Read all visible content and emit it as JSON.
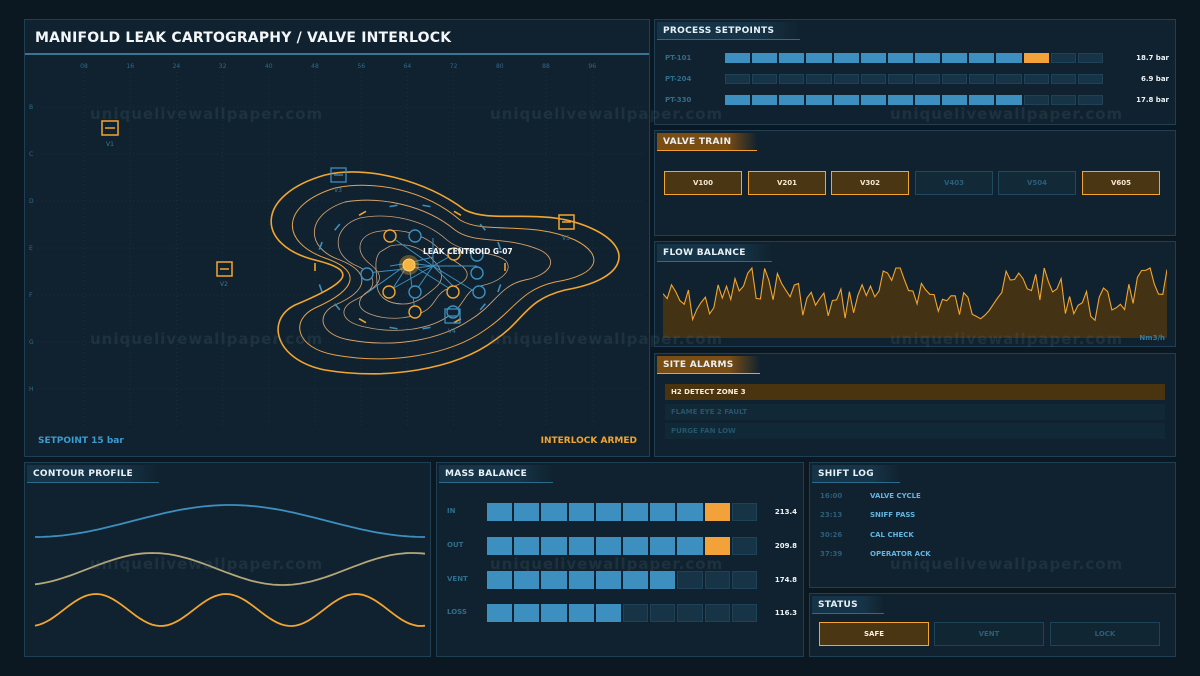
{
  "map": {
    "title": "MANIFOLD LEAK CARTOGRAPHY / VALVE INTERLOCK",
    "x_ticks": [
      "08",
      "16",
      "24",
      "32",
      "40",
      "48",
      "56",
      "64",
      "72",
      "80",
      "88",
      "96"
    ],
    "y_ticks": [
      "B",
      "C",
      "D",
      "E",
      "F",
      "G",
      "H"
    ],
    "valve_labels": [
      "V1",
      "V2",
      "V3",
      "V4",
      "V5"
    ],
    "centroid_label": "LEAK CENTROID  G-07",
    "setpoint": "SETPOINT 15 bar",
    "interlock": "INTERLOCK ARMED"
  },
  "setpoints": {
    "title": "PROCESS SETPOINTS",
    "rows": [
      {
        "label": "PT-101",
        "value": "18.7 bar",
        "level": 0.86
      },
      {
        "label": "PT-204",
        "value": "6.9 bar",
        "level": 0.0
      },
      {
        "label": "PT-330",
        "value": "17.8 bar",
        "level": 0.79
      }
    ]
  },
  "valve_train": {
    "title": "VALVE TRAIN",
    "valves": [
      {
        "label": "V100",
        "state": "on"
      },
      {
        "label": "V201",
        "state": "on"
      },
      {
        "label": "V302",
        "state": "on"
      },
      {
        "label": "V403",
        "state": "off"
      },
      {
        "label": "V504",
        "state": "off"
      },
      {
        "label": "V605",
        "state": "on"
      }
    ]
  },
  "flow": {
    "title": "FLOW BALANCE",
    "unit": "Nm3/h"
  },
  "alarms": {
    "title": "SITE ALARMS",
    "items": [
      {
        "label": "H2 DETECT ZONE 3",
        "active": true
      },
      {
        "label": "FLAME EYE 2 FAULT",
        "active": false
      },
      {
        "label": "PURGE FAN LOW",
        "active": false
      }
    ]
  },
  "contour": {
    "title": "CONTOUR PROFILE"
  },
  "mass": {
    "title": "MASS BALANCE",
    "rows": [
      {
        "label": "IN",
        "value": "213.4",
        "filled": 9
      },
      {
        "label": "OUT",
        "value": "209.8",
        "filled": 9
      },
      {
        "label": "VENT",
        "value": "174.8",
        "filled": 7
      },
      {
        "label": "LOSS",
        "value": "116.3",
        "filled": 5
      }
    ]
  },
  "shift": {
    "title": "SHIFT LOG",
    "entries": [
      {
        "time": "16:00",
        "event": "VALVE CYCLE"
      },
      {
        "time": "23:13",
        "event": "SNIFF PASS"
      },
      {
        "time": "30:26",
        "event": "CAL CHECK"
      },
      {
        "time": "37:39",
        "event": "OPERATOR ACK"
      }
    ]
  },
  "status": {
    "title": "STATUS",
    "buttons": [
      {
        "label": "SAFE",
        "active": true
      },
      {
        "label": "VENT",
        "active": false
      },
      {
        "label": "LOCK",
        "active": false
      }
    ]
  },
  "watermark": "uniquelivewallpaper.com",
  "colors": {
    "accent": "#f2a530",
    "blue": "#3d8fbf",
    "panel": "#10222f"
  }
}
